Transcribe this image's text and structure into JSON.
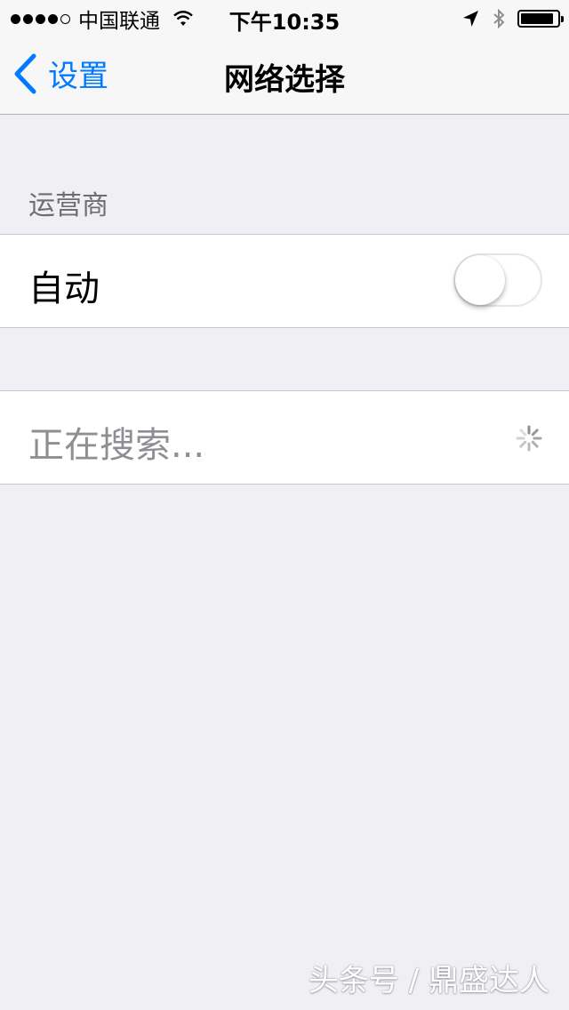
{
  "status_bar": {
    "signal_bars_filled": 4,
    "signal_bars_total": 5,
    "carrier": "中国联通",
    "time": "下午10:35",
    "battery_level": 0.9,
    "icons": [
      "wifi-icon",
      "location-arrow-icon",
      "bluetooth-icon",
      "battery-icon"
    ]
  },
  "nav": {
    "back_label": "设置",
    "title": "网络选择"
  },
  "carrier_section": {
    "header": "运营商",
    "auto_label": "自动",
    "auto_enabled": false
  },
  "network_list": {
    "searching_label": "正在搜索..."
  },
  "watermark": "头条号 / 鼎盛达人",
  "colors": {
    "accent": "#007aff",
    "background": "#efeff4",
    "header_text": "#6d6d72",
    "disabled_text": "#8e8e93"
  }
}
